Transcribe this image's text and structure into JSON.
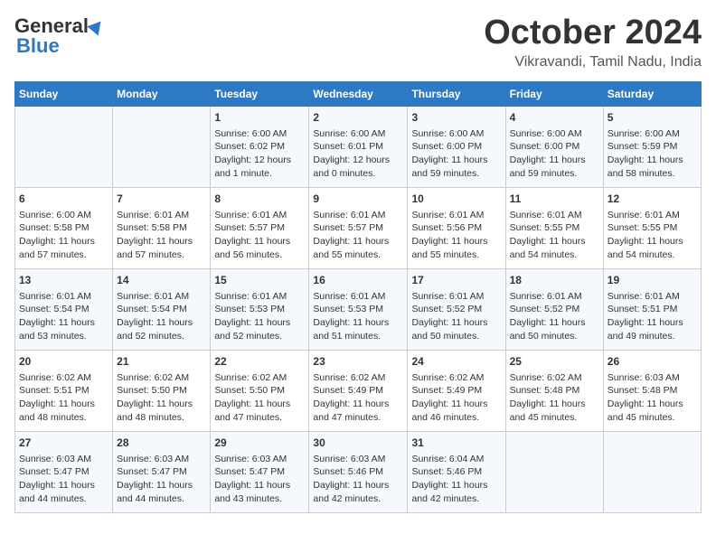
{
  "logo": {
    "general": "General",
    "blue": "Blue"
  },
  "title": "October 2024",
  "location": "Vikravandi, Tamil Nadu, India",
  "days_header": [
    "Sunday",
    "Monday",
    "Tuesday",
    "Wednesday",
    "Thursday",
    "Friday",
    "Saturday"
  ],
  "weeks": [
    [
      {
        "day": "",
        "info": ""
      },
      {
        "day": "",
        "info": ""
      },
      {
        "day": "1",
        "info": "Sunrise: 6:00 AM\nSunset: 6:02 PM\nDaylight: 12 hours\nand 1 minute."
      },
      {
        "day": "2",
        "info": "Sunrise: 6:00 AM\nSunset: 6:01 PM\nDaylight: 12 hours\nand 0 minutes."
      },
      {
        "day": "3",
        "info": "Sunrise: 6:00 AM\nSunset: 6:00 PM\nDaylight: 11 hours\nand 59 minutes."
      },
      {
        "day": "4",
        "info": "Sunrise: 6:00 AM\nSunset: 6:00 PM\nDaylight: 11 hours\nand 59 minutes."
      },
      {
        "day": "5",
        "info": "Sunrise: 6:00 AM\nSunset: 5:59 PM\nDaylight: 11 hours\nand 58 minutes."
      }
    ],
    [
      {
        "day": "6",
        "info": "Sunrise: 6:00 AM\nSunset: 5:58 PM\nDaylight: 11 hours\nand 57 minutes."
      },
      {
        "day": "7",
        "info": "Sunrise: 6:01 AM\nSunset: 5:58 PM\nDaylight: 11 hours\nand 57 minutes."
      },
      {
        "day": "8",
        "info": "Sunrise: 6:01 AM\nSunset: 5:57 PM\nDaylight: 11 hours\nand 56 minutes."
      },
      {
        "day": "9",
        "info": "Sunrise: 6:01 AM\nSunset: 5:57 PM\nDaylight: 11 hours\nand 55 minutes."
      },
      {
        "day": "10",
        "info": "Sunrise: 6:01 AM\nSunset: 5:56 PM\nDaylight: 11 hours\nand 55 minutes."
      },
      {
        "day": "11",
        "info": "Sunrise: 6:01 AM\nSunset: 5:55 PM\nDaylight: 11 hours\nand 54 minutes."
      },
      {
        "day": "12",
        "info": "Sunrise: 6:01 AM\nSunset: 5:55 PM\nDaylight: 11 hours\nand 54 minutes."
      }
    ],
    [
      {
        "day": "13",
        "info": "Sunrise: 6:01 AM\nSunset: 5:54 PM\nDaylight: 11 hours\nand 53 minutes."
      },
      {
        "day": "14",
        "info": "Sunrise: 6:01 AM\nSunset: 5:54 PM\nDaylight: 11 hours\nand 52 minutes."
      },
      {
        "day": "15",
        "info": "Sunrise: 6:01 AM\nSunset: 5:53 PM\nDaylight: 11 hours\nand 52 minutes."
      },
      {
        "day": "16",
        "info": "Sunrise: 6:01 AM\nSunset: 5:53 PM\nDaylight: 11 hours\nand 51 minutes."
      },
      {
        "day": "17",
        "info": "Sunrise: 6:01 AM\nSunset: 5:52 PM\nDaylight: 11 hours\nand 50 minutes."
      },
      {
        "day": "18",
        "info": "Sunrise: 6:01 AM\nSunset: 5:52 PM\nDaylight: 11 hours\nand 50 minutes."
      },
      {
        "day": "19",
        "info": "Sunrise: 6:01 AM\nSunset: 5:51 PM\nDaylight: 11 hours\nand 49 minutes."
      }
    ],
    [
      {
        "day": "20",
        "info": "Sunrise: 6:02 AM\nSunset: 5:51 PM\nDaylight: 11 hours\nand 48 minutes."
      },
      {
        "day": "21",
        "info": "Sunrise: 6:02 AM\nSunset: 5:50 PM\nDaylight: 11 hours\nand 48 minutes."
      },
      {
        "day": "22",
        "info": "Sunrise: 6:02 AM\nSunset: 5:50 PM\nDaylight: 11 hours\nand 47 minutes."
      },
      {
        "day": "23",
        "info": "Sunrise: 6:02 AM\nSunset: 5:49 PM\nDaylight: 11 hours\nand 47 minutes."
      },
      {
        "day": "24",
        "info": "Sunrise: 6:02 AM\nSunset: 5:49 PM\nDaylight: 11 hours\nand 46 minutes."
      },
      {
        "day": "25",
        "info": "Sunrise: 6:02 AM\nSunset: 5:48 PM\nDaylight: 11 hours\nand 45 minutes."
      },
      {
        "day": "26",
        "info": "Sunrise: 6:03 AM\nSunset: 5:48 PM\nDaylight: 11 hours\nand 45 minutes."
      }
    ],
    [
      {
        "day": "27",
        "info": "Sunrise: 6:03 AM\nSunset: 5:47 PM\nDaylight: 11 hours\nand 44 minutes."
      },
      {
        "day": "28",
        "info": "Sunrise: 6:03 AM\nSunset: 5:47 PM\nDaylight: 11 hours\nand 44 minutes."
      },
      {
        "day": "29",
        "info": "Sunrise: 6:03 AM\nSunset: 5:47 PM\nDaylight: 11 hours\nand 43 minutes."
      },
      {
        "day": "30",
        "info": "Sunrise: 6:03 AM\nSunset: 5:46 PM\nDaylight: 11 hours\nand 42 minutes."
      },
      {
        "day": "31",
        "info": "Sunrise: 6:04 AM\nSunset: 5:46 PM\nDaylight: 11 hours\nand 42 minutes."
      },
      {
        "day": "",
        "info": ""
      },
      {
        "day": "",
        "info": ""
      }
    ]
  ]
}
